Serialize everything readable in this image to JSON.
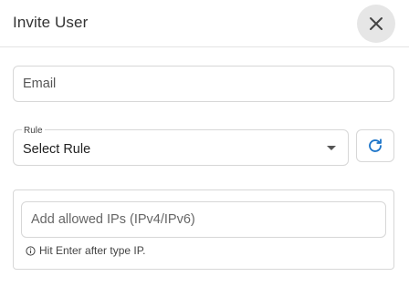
{
  "dialog": {
    "title": "Invite User",
    "close_icon": "close-icon"
  },
  "email": {
    "placeholder": "Email",
    "value": ""
  },
  "rule": {
    "label": "Rule",
    "selected": "Select Rule",
    "caret_icon": "caret-down-icon",
    "refresh_icon": "refresh-icon",
    "refresh_color": "#1a73c8"
  },
  "allowed_ips": {
    "placeholder": "Add allowed IPs (IPv4/IPv6)",
    "value": "",
    "hint": "Hit Enter after type IP.",
    "hint_icon": "info-icon"
  }
}
